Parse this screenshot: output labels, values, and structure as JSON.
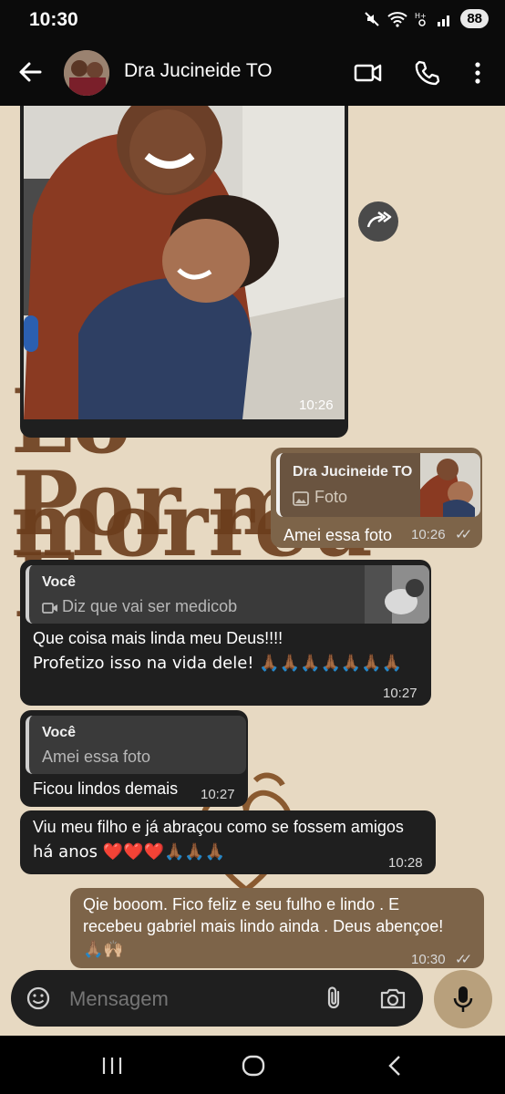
{
  "status": {
    "time": "10:30",
    "battery": "88"
  },
  "header": {
    "contact_name": "Dra Jucineide TO"
  },
  "wallpaper": {
    "line1": "Lo morreu",
    "line2": "Por mi",
    "line3": "E"
  },
  "messages": [
    {
      "id": "m1",
      "type": "image",
      "time": "10:26"
    },
    {
      "id": "m2",
      "quote_name": "Dra Jucineide TO",
      "quote_text": "Foto",
      "text": "Amei essa foto",
      "time": "10:26"
    },
    {
      "id": "m3",
      "quote_name": "Você",
      "quote_text": "Diz que vai ser medicob",
      "line1": "Que coisa mais linda meu Deus!!!!",
      "line2": "Profetizo isso na vida dele! 🙏🏾🙏🏾🙏🏾🙏🏾🙏🏾🙏🏾🙏🏾",
      "time": "10:27"
    },
    {
      "id": "m4",
      "quote_name": "Você",
      "quote_text": "Amei essa foto",
      "text": "Ficou lindos demais",
      "time": "10:27"
    },
    {
      "id": "m5",
      "line1": "Viu meu filho e já abraçou como se fossem amigos",
      "line2": "há anos ❤️❤️❤️🙏🏾🙏🏾🙏🏾",
      "time": "10:28"
    },
    {
      "id": "m6",
      "line1": "Qie booom. Fico feliz e seu fulho e lindo . E",
      "line2": "recebeu gabriel mais lindo ainda . Deus abençoe!",
      "line3": "🙏🏽🙌🏼",
      "time": "10:30"
    }
  ],
  "composer": {
    "placeholder": "Mensagem"
  },
  "icons": [
    "back-icon",
    "video-call-icon",
    "phone-icon",
    "more-icon",
    "forward-icon",
    "emoji-icon",
    "attach-icon",
    "camera-icon",
    "mic-icon",
    "photo-icon",
    "video-icon"
  ],
  "colors": {
    "bubble_in": "#1f1f1f",
    "bubble_out": "#7d6449",
    "wallpaper": "#e7d9c2"
  }
}
